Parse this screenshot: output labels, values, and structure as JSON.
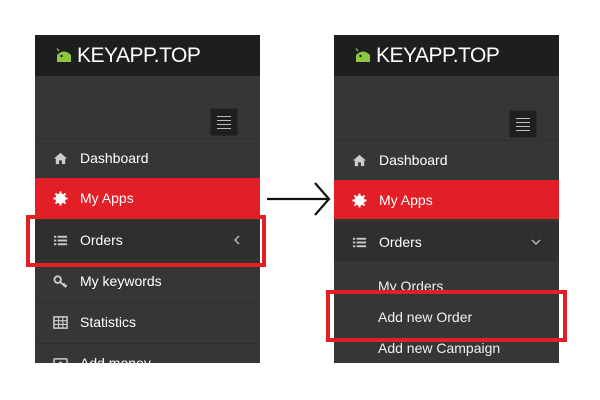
{
  "left_panel": {
    "brand": "KEYAPP.TOP",
    "menu": [
      {
        "label": "Dashboard",
        "icon": "home-icon"
      },
      {
        "label": "My Apps",
        "icon": "gear-icon"
      },
      {
        "label": "Orders",
        "icon": "list-icon",
        "toggle": "chevron-left-icon"
      },
      {
        "label": "My keywords",
        "icon": "key-icon"
      },
      {
        "label": "Statistics",
        "icon": "table-icon"
      },
      {
        "label": "Add money",
        "icon": "wallet-icon"
      }
    ]
  },
  "right_panel": {
    "brand": "KEYAPP.TOP",
    "menu": [
      {
        "label": "Dashboard",
        "icon": "home-icon"
      },
      {
        "label": "My Apps",
        "icon": "gear-icon"
      },
      {
        "label": "Orders",
        "icon": "list-icon",
        "toggle": "chevron-down-icon"
      }
    ],
    "submenu": [
      "My Orders",
      "Add new Order",
      "Add new Campaign"
    ]
  },
  "colors": {
    "brand_green": "#8dc63f",
    "active_red": "#e21f26",
    "sidebar_bg": "#363636",
    "header_bg": "#1e1e1e"
  }
}
